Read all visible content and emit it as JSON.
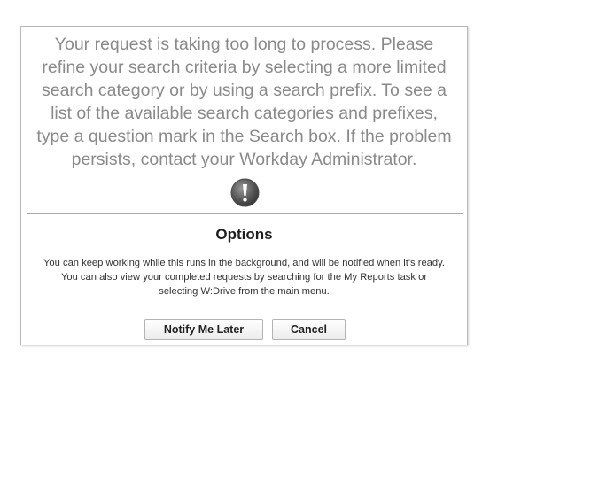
{
  "dialog": {
    "message_lines": [
      "Your request is taking too long to process. Please",
      "refine your search criteria by selecting a more limited",
      "search category or by using a search prefix. To see a",
      "list of the available search categories and prefixes,",
      "type a question mark in the Search box. If the problem",
      "persists, contact your Workday Administrator."
    ],
    "icon": "exclamation-icon",
    "options_title": "Options",
    "options_lines": [
      "You can keep working while this runs in the background, and will be notified when it's ready.",
      "You can also view your completed requests by searching for the My Reports task or",
      "selecting W:Drive from the main menu."
    ],
    "buttons": {
      "notify_label": "Notify Me Later",
      "cancel_label": "Cancel"
    }
  }
}
